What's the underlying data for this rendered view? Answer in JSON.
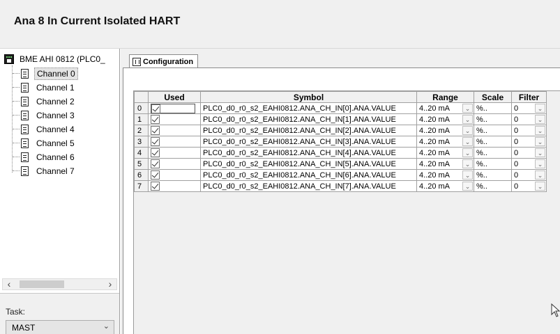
{
  "header": {
    "title": "Ana 8 In Current Isolated HART"
  },
  "tree": {
    "root_label": "BME AHI 0812 (PLC0_",
    "items": [
      {
        "label": "Channel 0",
        "selected": true
      },
      {
        "label": "Channel 1"
      },
      {
        "label": "Channel 2"
      },
      {
        "label": "Channel 3"
      },
      {
        "label": "Channel 4"
      },
      {
        "label": "Channel 5"
      },
      {
        "label": "Channel 6"
      },
      {
        "label": "Channel 7"
      }
    ]
  },
  "task": {
    "label": "Task:",
    "value": "MAST"
  },
  "tabs": [
    {
      "label": "Configuration",
      "active": true
    }
  ],
  "table": {
    "headers": [
      "",
      "Used",
      "Symbol",
      "Range",
      "Scale",
      "Filter"
    ],
    "rows": [
      {
        "num": "0",
        "used": true,
        "symbol": "PLC0_d0_r0_s2_EAHI0812.ANA_CH_IN[0].ANA.VALUE",
        "range": "4..20 mA",
        "scale": "%..",
        "filter": "0"
      },
      {
        "num": "1",
        "used": true,
        "symbol": "PLC0_d0_r0_s2_EAHI0812.ANA_CH_IN[1].ANA.VALUE",
        "range": "4..20 mA",
        "scale": "%..",
        "filter": "0"
      },
      {
        "num": "2",
        "used": true,
        "symbol": "PLC0_d0_r0_s2_EAHI0812.ANA_CH_IN[2].ANA.VALUE",
        "range": "4..20 mA",
        "scale": "%..",
        "filter": "0"
      },
      {
        "num": "3",
        "used": true,
        "symbol": "PLC0_d0_r0_s2_EAHI0812.ANA_CH_IN[3].ANA.VALUE",
        "range": "4..20 mA",
        "scale": "%..",
        "filter": "0"
      },
      {
        "num": "4",
        "used": true,
        "symbol": "PLC0_d0_r0_s2_EAHI0812.ANA_CH_IN[4].ANA.VALUE",
        "range": "4..20 mA",
        "scale": "%..",
        "filter": "0"
      },
      {
        "num": "5",
        "used": true,
        "symbol": "PLC0_d0_r0_s2_EAHI0812.ANA_CH_IN[5].ANA.VALUE",
        "range": "4..20 mA",
        "scale": "%..",
        "filter": "0"
      },
      {
        "num": "6",
        "used": true,
        "symbol": "PLC0_d0_r0_s2_EAHI0812.ANA_CH_IN[6].ANA.VALUE",
        "range": "4..20 mA",
        "scale": "%..",
        "filter": "0"
      },
      {
        "num": "7",
        "used": true,
        "symbol": "PLC0_d0_r0_s2_EAHI0812.ANA_CH_IN[7].ANA.VALUE",
        "range": "4..20 mA",
        "scale": "%..",
        "filter": "0"
      }
    ]
  },
  "icons": {
    "root": "module-icon",
    "item": "document-icon",
    "tab": "configuration-icon",
    "dropdown": "chevron-down-icon",
    "cursor": "mouse-pointer-icon"
  }
}
